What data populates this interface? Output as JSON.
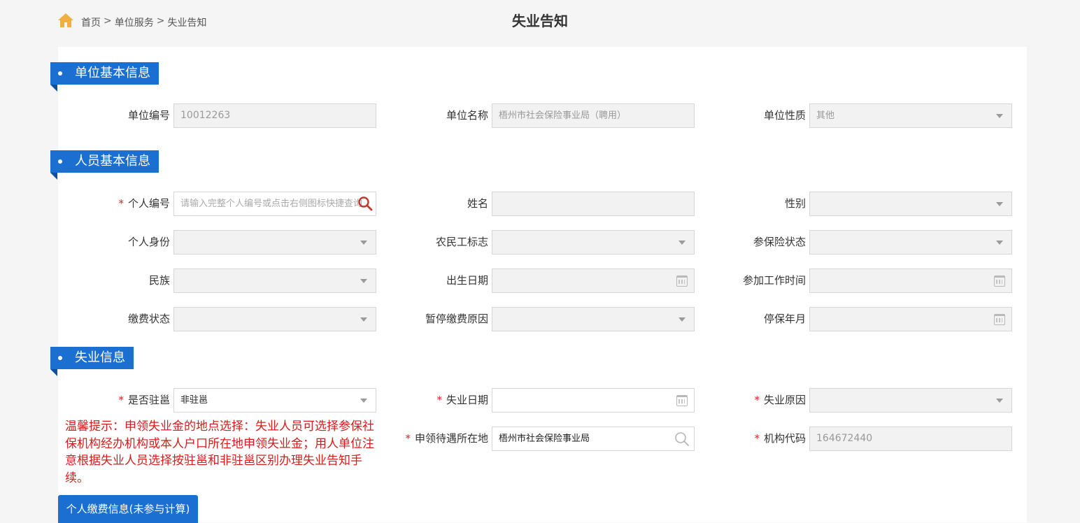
{
  "breadcrumb": {
    "home": "首页",
    "sep": ">",
    "level1": "单位服务",
    "level2": "失业告知"
  },
  "page_title": "失业告知",
  "sections": {
    "unit": "单位基本信息",
    "person": "人员基本信息",
    "unemployment": "失业信息"
  },
  "required_mark": "*",
  "unit_info": {
    "unit_no_label": "单位编号",
    "unit_no_value": "10012263",
    "unit_name_label": "单位名称",
    "unit_name_value": "梧州市社会保险事业局（聘用）",
    "unit_type_label": "单位性质",
    "unit_type_value": "其他"
  },
  "person_info": {
    "person_no_label": "个人编号",
    "person_no_placeholder": "请输入完整个人编号或点击右侧图标快捷查询",
    "name_label": "姓名",
    "gender_label": "性别",
    "identity_label": "个人身份",
    "migrant_label": "农民工标志",
    "ins_status_label": "参保险状态",
    "ethnic_label": "民族",
    "birth_label": "出生日期",
    "work_start_label": "参加工作时间",
    "pay_status_label": "缴费状态",
    "pause_reason_label": "暂停缴费原因",
    "stop_month_label": "停保年月"
  },
  "unemployment_info": {
    "in_gx_label": "是否驻邕",
    "in_gx_value": "非驻邕",
    "date_label": "失业日期",
    "reason_label": "失业原因",
    "location_label": "申领待遇所在地",
    "location_value": "梧州市社会保险事业局",
    "org_code_label": "机构代码",
    "org_code_value": "164672440"
  },
  "warning": "温馨提示：申领失业金的地点选择：失业人员可选择参保社保机构经办机构或本人户口所在地申领失业金；用人单位注意根据失业人员选择按驻邕和非驻邕区别办理失业告知手续。",
  "pay_info_button": "个人缴费信息(未参与计算)",
  "colors": {
    "primary": "#1a6fd0",
    "warning": "#d61c1c",
    "home_icon": "#f0b040"
  }
}
